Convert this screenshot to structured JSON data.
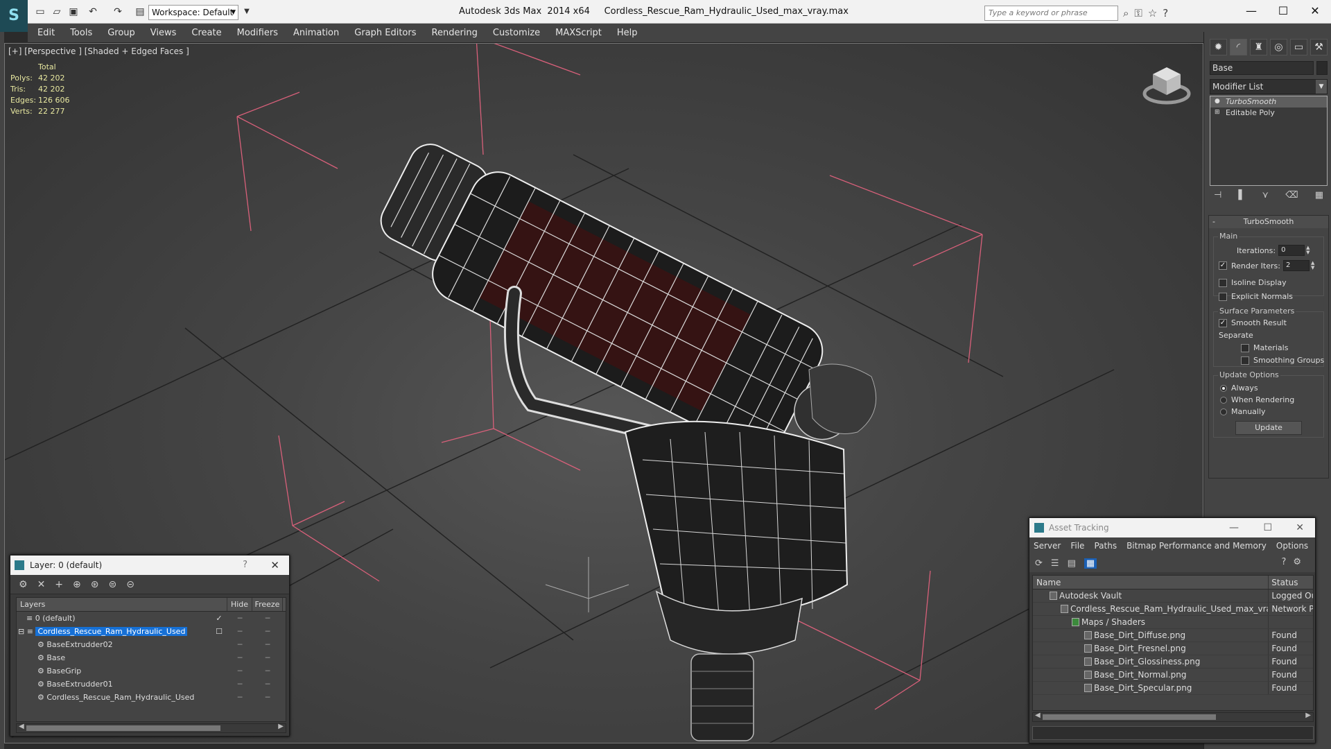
{
  "window": {
    "app_title": "Autodesk 3ds Max  2014 x64",
    "file_title": "Cordless_Rescue_Ram_Hydraulic_Used_max_vray.max",
    "workspace": "Workspace: Default",
    "search_placeholder": "Type a keyword or phrase"
  },
  "menu": [
    "Edit",
    "Tools",
    "Group",
    "Views",
    "Create",
    "Modifiers",
    "Animation",
    "Graph Editors",
    "Rendering",
    "Customize",
    "MAXScript",
    "Help"
  ],
  "viewport": {
    "label": "[+] [Perspective ] [Shaded + Edged Faces ]",
    "stats": {
      "header": "Total",
      "rows": [
        {
          "k": "Polys:",
          "v": "42 202"
        },
        {
          "k": "Tris:",
          "v": "42 202"
        },
        {
          "k": "Edges:",
          "v": "126 606"
        },
        {
          "k": "Verts:",
          "v": "22 277"
        }
      ]
    }
  },
  "command_panel": {
    "object_name": "Base",
    "modifier_list": "Modifier List",
    "stack": [
      "TurboSmooth",
      "Editable Poly"
    ],
    "rollout_title": "TurboSmooth",
    "main_group": "Main",
    "iterations_label": "Iterations:",
    "iterations_value": "0",
    "render_iters_label": "Render Iters:",
    "render_iters_value": "2",
    "isoline": "Isoline Display",
    "explicit_normals": "Explicit Normals",
    "surface_group": "Surface Parameters",
    "smooth_result": "Smooth Result",
    "separate": "Separate",
    "materials": "Materials",
    "smoothing_groups": "Smoothing Groups",
    "update_group": "Update Options",
    "always": "Always",
    "when_rendering": "When Rendering",
    "manually": "Manually",
    "update_button": "Update"
  },
  "layer_window": {
    "title": "Layer: 0 (default)",
    "help": "?",
    "columns": {
      "layers": "Layers",
      "hide": "Hide",
      "freeze": "Freeze"
    },
    "rows": [
      {
        "name": "0 (default)",
        "indent": 1,
        "current": "✓",
        "sel": false
      },
      {
        "name": "Cordless_Rescue_Ram_Hydraulic_Used",
        "indent": 1,
        "current": "☐",
        "sel": true
      },
      {
        "name": "BaseExtrudder02",
        "indent": 2,
        "current": "",
        "sel": false
      },
      {
        "name": "Base",
        "indent": 2,
        "current": "",
        "sel": false
      },
      {
        "name": "BaseGrip",
        "indent": 2,
        "current": "",
        "sel": false
      },
      {
        "name": "BaseExtrudder01",
        "indent": 2,
        "current": "",
        "sel": false
      },
      {
        "name": "Cordless_Rescue_Ram_Hydraulic_Used",
        "indent": 2,
        "current": "",
        "sel": false
      }
    ]
  },
  "asset_window": {
    "title": "Asset Tracking",
    "menu": [
      "Server",
      "File",
      "Paths",
      "Bitmap Performance and Memory",
      "Options"
    ],
    "columns": {
      "name": "Name",
      "status": "Status"
    },
    "rows": [
      {
        "name": "Autodesk Vault",
        "indent": 1,
        "status": "Logged Ou"
      },
      {
        "name": "Cordless_Rescue_Ram_Hydraulic_Used_max_vray.max",
        "indent": 2,
        "status": "Network Pa"
      },
      {
        "name": "Maps / Shaders",
        "indent": 3,
        "status": ""
      },
      {
        "name": "Base_Dirt_Diffuse.png",
        "indent": 4,
        "status": "Found"
      },
      {
        "name": "Base_Dirt_Fresnel.png",
        "indent": 4,
        "status": "Found"
      },
      {
        "name": "Base_Dirt_Glossiness.png",
        "indent": 4,
        "status": "Found"
      },
      {
        "name": "Base_Dirt_Normal.png",
        "indent": 4,
        "status": "Found"
      },
      {
        "name": "Base_Dirt_Specular.png",
        "indent": 4,
        "status": "Found"
      }
    ]
  }
}
